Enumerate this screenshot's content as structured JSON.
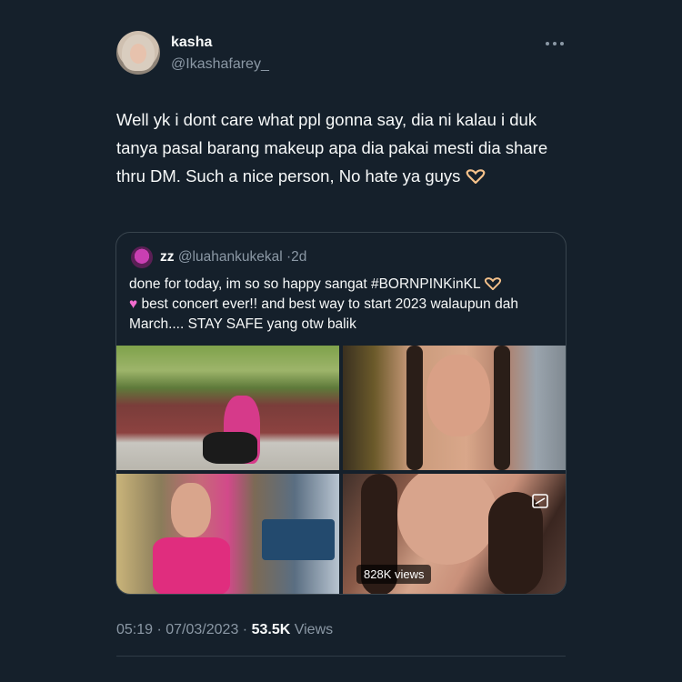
{
  "author": {
    "display_name": "kasha",
    "handle": "@Ikashafarey_"
  },
  "tweet": {
    "text": "Well yk i dont care what ppl gonna say, dia ni kalau i duk tanya pasal barang makeup apa dia pakai mesti dia share thru DM. Such a nice person, No hate ya guys",
    "timestamp": "05:19 · 07/03/2023",
    "views_count": "53.5K",
    "views_label": "Views"
  },
  "quote": {
    "display_name": "zz",
    "handle": "@luahankukekal",
    "dot": "·",
    "age": "2d",
    "text_line1": "done for today, im so so happy sangat #BORNPINKinKL",
    "text_line2": "best concert ever!! and best way to start 2023 walaupun dah March.... STAY SAFE yang otw balik",
    "video_views": "828K views"
  },
  "icons": [
    "more-icon",
    "heart-hands-emoji",
    "pink-heart-emoji",
    "gif-icon"
  ],
  "colors": {
    "background": "#15202b",
    "text": "#f7f9f9",
    "muted": "#8b98a5",
    "border": "#38444d"
  }
}
